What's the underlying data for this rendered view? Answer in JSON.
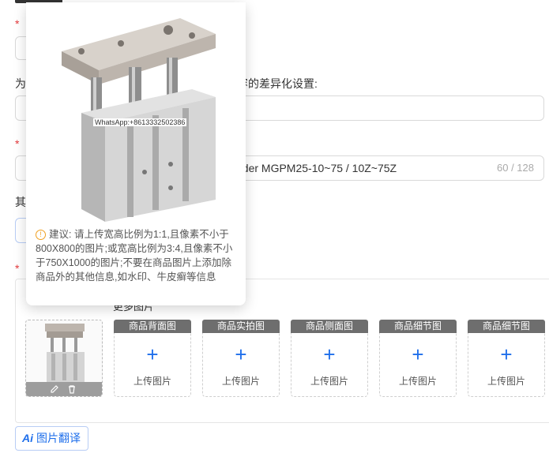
{
  "form": {
    "required_mark": "*",
    "row1_fragment": "为",
    "diff_text": "容的差异化设置:",
    "title_value": "nder MGPM25-10~75 / 10Z~75Z",
    "title_counter": "60 / 128",
    "other_fragment": "其",
    "images_title_fragment": "更多图片"
  },
  "popup": {
    "watermark": "WhatsApp:+8613332502386",
    "tip": "建议: 请上传宽高比例为1:1,且像素不小于800X800的图片;或宽高比例为3:4,且像素不小于750X1000的图片;不要在商品图片上添加除商品外的其他信息,如水印、牛皮癣等信息"
  },
  "images": {
    "slots": [
      {
        "header": "商品背面图",
        "action": "上传图片"
      },
      {
        "header": "商品实拍图",
        "action": "上传图片"
      },
      {
        "header": "商品侧面图",
        "action": "上传图片"
      },
      {
        "header": "商品细节图",
        "action": "上传图片"
      },
      {
        "header": "商品细节图",
        "action": "上传图片"
      }
    ],
    "thumb_icons": [
      "edit-icon",
      "trash-icon"
    ]
  },
  "translate_button": {
    "icon": "Ai",
    "label": "图片翻译"
  },
  "colors": {
    "accent": "#1f6feb",
    "required": "#e4393c",
    "slot_header": "#6e6e6e"
  }
}
